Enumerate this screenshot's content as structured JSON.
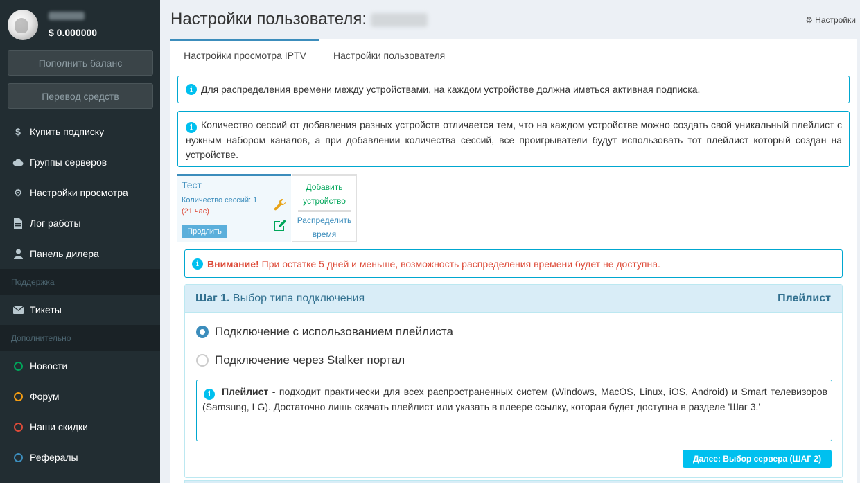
{
  "sidebar": {
    "balance": "$ 0.000000",
    "buttons": {
      "top_up": "Пополнить баланс",
      "transfer": "Перевод средств"
    },
    "items": [
      {
        "label": "Купить подписку",
        "icon": "dollar-icon"
      },
      {
        "label": "Группы серверов",
        "icon": "cloud-icon"
      },
      {
        "label": "Настройки просмотра",
        "icon": "gear-icon"
      },
      {
        "label": "Лог работы",
        "icon": "document-icon"
      },
      {
        "label": "Панель дилера",
        "icon": "user-icon"
      }
    ],
    "support_header": "Поддержка",
    "tickets": "Тикеты",
    "extra_header": "Дополнительно",
    "extras": [
      {
        "label": "Новости",
        "color": "#00a65a"
      },
      {
        "label": "Форум",
        "color": "#f39c12"
      },
      {
        "label": "Наши скидки",
        "color": "#dd4b39"
      },
      {
        "label": "Рефералы",
        "color": "#3c8dbc"
      }
    ]
  },
  "header": {
    "title": "Настройки пользователя:",
    "settings_link": "Настройки"
  },
  "tabs": {
    "iptv": "Настройки просмотра IPTV",
    "user": "Настройки пользователя"
  },
  "info": {
    "distribution": "Для распределения времени между устройствами, на каждом устройстве должна иметься активная подписка.",
    "sessions": "Количество сессий от добавления разных устройств отличается тем, что на каждом устройстве можно создать свой уникальный плейлист с нужным набором каналов, а при добавлении количества сессий, все проигрыватели будут использовать тот плейлист который создан на устройстве."
  },
  "device": {
    "name": "Тест",
    "sessions": "Количество сессий: 1",
    "time": "(21 час)",
    "extend": "Продлить"
  },
  "add_card": {
    "add_line1": "Добавить",
    "add_line2": "устройство",
    "distr_line1": "Распределить",
    "distr_line2": "время"
  },
  "warning": {
    "label": "Внимание!",
    "text": "При остатке 5 дней и меньше, возможность распределения времени будет не доступна."
  },
  "step": {
    "number": "Шаг 1.",
    "title": "Выбор типа подключения",
    "current": "Плейлист",
    "option_playlist": "Подключение с использованием плейлиста",
    "option_stalker": "Подключение через Stalker портал",
    "desc_bold": "Плейлист",
    "desc_text": " - подходит практически для всех распространенных систем (Windows, MacOS, Linux, iOS, Android) и Smart телевизоров (Samsung, LG). Достаточно лишь скачать плейлист или указать в плеере ссылку, которая будет доступна в разделе 'Шаг 3.'",
    "next_button": "Далее: Выбор сервера (ШАГ 2)"
  }
}
